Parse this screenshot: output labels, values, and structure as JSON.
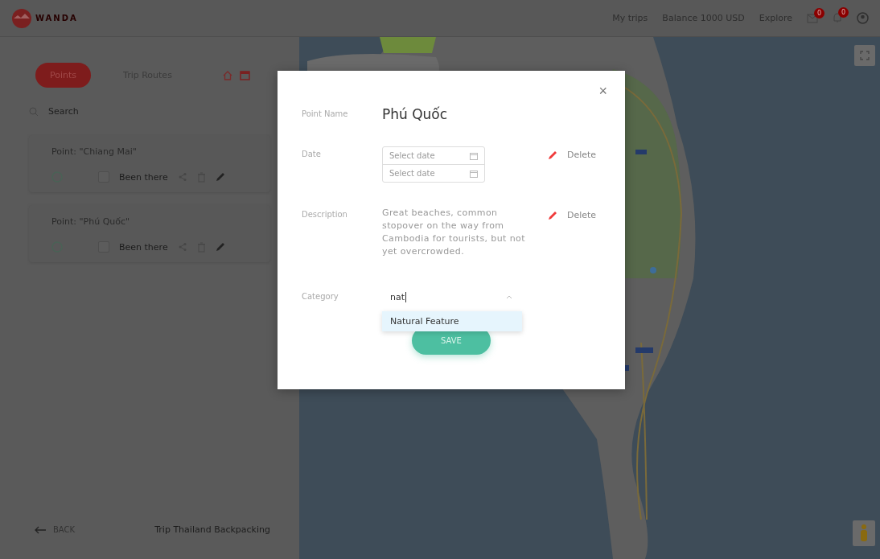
{
  "header": {
    "logo": "WANDA",
    "nav": [
      "My trips",
      "Balance 1000 USD",
      "Explore"
    ],
    "mail_badge": "0",
    "bell_badge": "0"
  },
  "sidebar": {
    "tabs": [
      {
        "label": "Points",
        "selected": true
      },
      {
        "label": "Trip Routes",
        "selected": false
      }
    ],
    "search": {
      "placeholder": "Search"
    },
    "points": [
      {
        "title": "Point: \"Chiang Mai\"",
        "been_there": {
          "label": "Been there",
          "checked": false
        }
      },
      {
        "title": "Point: \"Phú Quốc\"",
        "been_there": {
          "label": "Been there",
          "checked": false
        }
      }
    ],
    "back": "BACK",
    "trip": "Trip Thailand Backpacking"
  },
  "modal": {
    "close": "×",
    "rows": [
      {
        "kind": "name",
        "label": "Point Name",
        "value": "Phú Quốc"
      },
      {
        "kind": "date",
        "label": "Date",
        "fields": [
          {
            "placeholder": "Select date"
          },
          {
            "placeholder": "Select date"
          }
        ],
        "action": "Delete"
      },
      {
        "kind": "text",
        "label": "Description",
        "value": "Great beaches, common stopover on the way from Cambodia for tourists, but not yet overcrowded.",
        "action": "Delete"
      },
      {
        "kind": "select",
        "label": "Category",
        "value": "nat",
        "options": [
          {
            "label": "Natural Feature",
            "selected": true
          }
        ]
      }
    ],
    "save": "SAVE"
  }
}
